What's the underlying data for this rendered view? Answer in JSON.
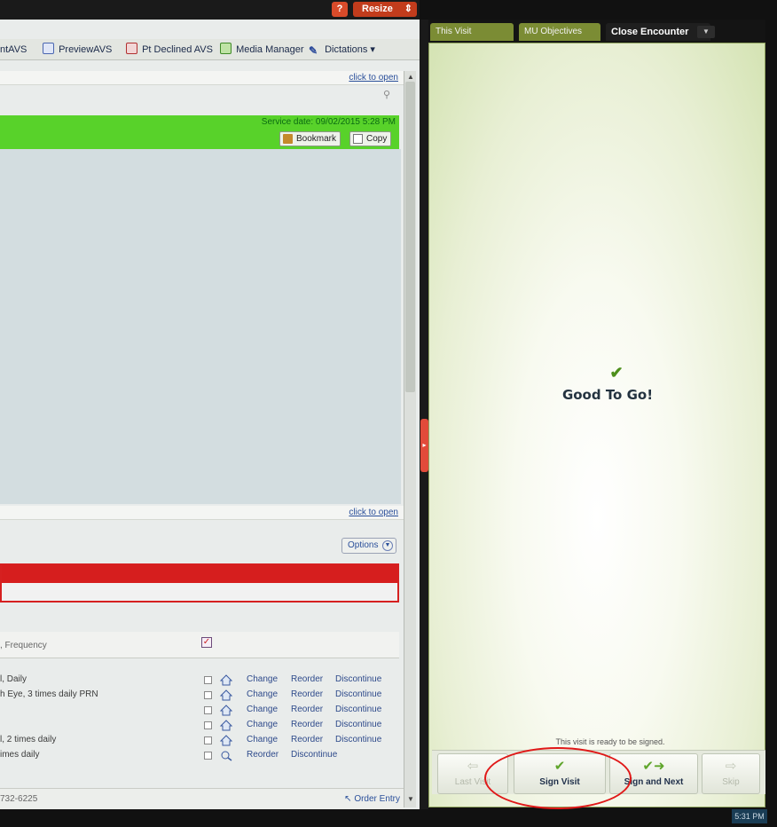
{
  "header": {
    "help_label": "?",
    "resize_label": "Resize",
    "resize_arrow": "⇕"
  },
  "toolbar": {
    "items": [
      {
        "label": "ntAVS",
        "icon": "print-icon"
      },
      {
        "label": "PreviewAVS",
        "icon": "preview-icon"
      },
      {
        "label": "Pt Declined AVS",
        "icon": "declined-icon"
      },
      {
        "label": "Media Manager",
        "icon": "media-icon"
      },
      {
        "label": "Dictations",
        "icon": "dictation-icon"
      }
    ],
    "dictations_arrow": "▾"
  },
  "note": {
    "click_to_open_top": "click to open",
    "service_date": "Service date: 09/02/2015 5:28 PM",
    "bookmark_label": "Bookmark",
    "copy_label": "Copy",
    "click_to_open_bottom": "click to open"
  },
  "meds": {
    "options_label": "Options",
    "header_text": ", Frequency",
    "rows": [
      {
        "name": "l, Daily",
        "actions": [
          "Change",
          "Reorder",
          "Discontinue"
        ]
      },
      {
        "name": "h Eye, 3 times daily PRN",
        "actions": [
          "Change",
          "Reorder",
          "Discontinue"
        ]
      },
      {
        "name": "",
        "actions": [
          "Change",
          "Reorder",
          "Discontinue"
        ]
      },
      {
        "name": "",
        "actions": [
          "Change",
          "Reorder",
          "Discontinue"
        ]
      },
      {
        "name": "l, 2 times daily",
        "actions": [
          "Change",
          "Reorder",
          "Discontinue"
        ]
      },
      {
        "name": "imes daily",
        "actions": [
          "Reorder",
          "Discontinue"
        ]
      }
    ],
    "phone": "732-6225",
    "order_entry": "Order Entry"
  },
  "tabs": [
    {
      "label": "This Visit",
      "active": false
    },
    {
      "label": "MU Objectives",
      "active": false
    },
    {
      "label": "Close Encounter",
      "active": true
    }
  ],
  "encounter": {
    "status_title": "Good To Go!",
    "ready_text": "This visit is ready to be signed.",
    "buttons": {
      "last_visit": "Last Visit",
      "sign_visit": "Sign Visit",
      "sign_and_next": "Sign and Next",
      "skip": "Skip"
    }
  },
  "clock": "5:31 PM",
  "colors": {
    "accent_green": "#58d22a",
    "alert_red": "#d61e1e",
    "tab_olive": "#7b8c34",
    "check_green": "#4d8f1c"
  }
}
